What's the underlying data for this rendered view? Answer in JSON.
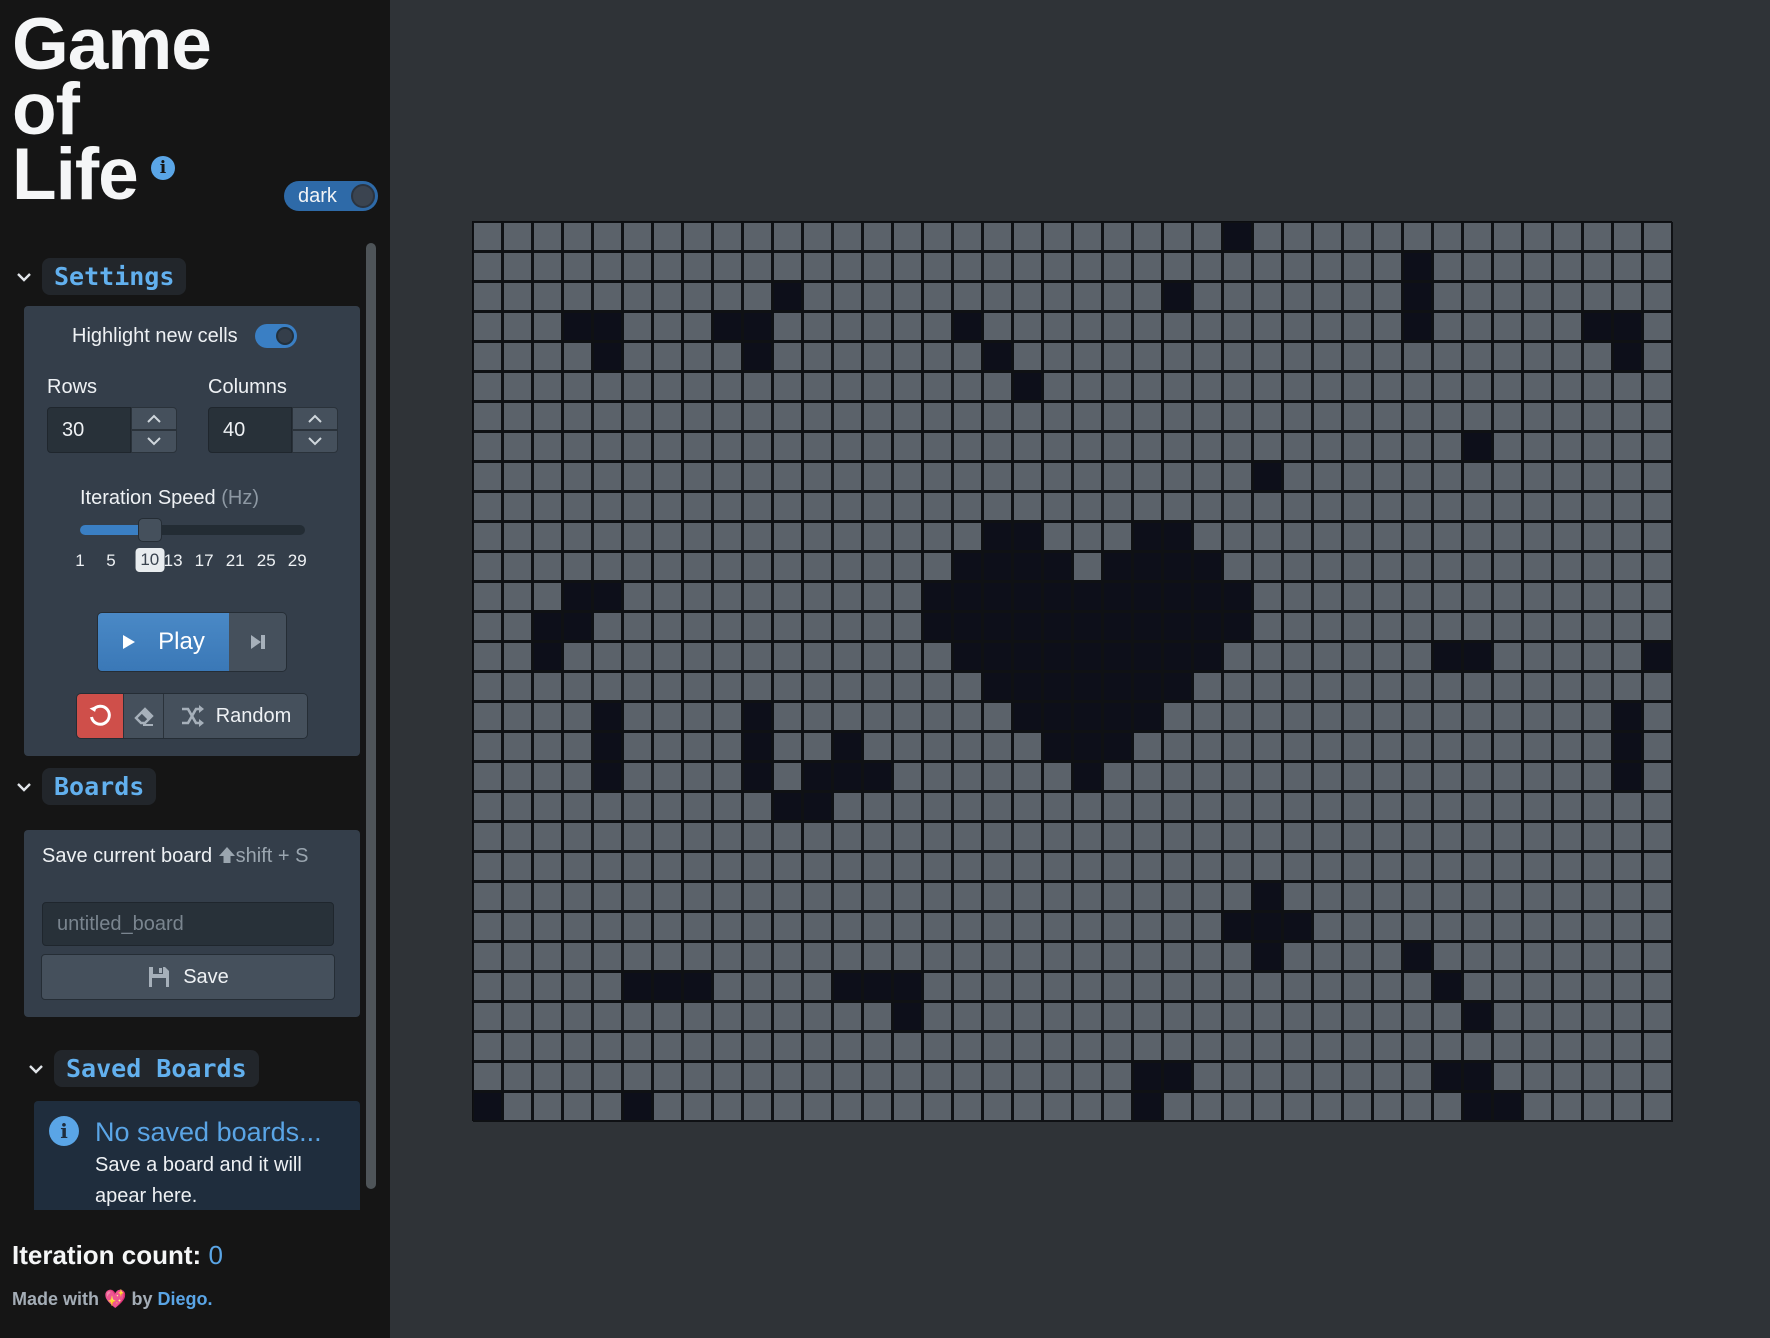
{
  "app": {
    "title_lines": [
      "Game",
      "of",
      "Life"
    ],
    "info_icon": "info-icon",
    "theme_toggle": {
      "label": "dark",
      "on": true
    }
  },
  "settings": {
    "header": "Settings",
    "highlight_new_cells": {
      "label": "Highlight new cells",
      "on": true
    },
    "rows": {
      "label": "Rows",
      "value": "30"
    },
    "columns": {
      "label": "Columns",
      "value": "40"
    },
    "iteration_speed": {
      "label": "Iteration Speed",
      "unit": "(Hz)",
      "value": 10,
      "min": 1,
      "max": 30,
      "ticks": [
        "1",
        "5",
        "10",
        "13",
        "17",
        "21",
        "25",
        "29"
      ],
      "tick_values": [
        1,
        5,
        10,
        13,
        17,
        21,
        25,
        29
      ]
    },
    "play_label": "Play",
    "random_label": "Random",
    "icons": {
      "play": "play-icon",
      "step": "step-forward-icon",
      "reset": "reset-icon",
      "clear": "eraser-icon",
      "random": "shuffle-icon"
    }
  },
  "boards": {
    "header": "Boards",
    "save_label": "Save current board",
    "shortcut": "shift + S",
    "name_placeholder": "untitled_board",
    "name_value": "",
    "save_button": "Save"
  },
  "saved_boards": {
    "header": "Saved Boards",
    "empty_title": "No saved boards...",
    "empty_body": "Save a board and it will apear here."
  },
  "footer": {
    "iteration_label": "Iteration count:",
    "iteration_count": "0",
    "made_with": "Made with",
    "heart": "💖",
    "by": "by",
    "author": "Diego."
  },
  "board": {
    "rows": 30,
    "cols": 40,
    "alive_color": "#0d0f1a",
    "dead_color": "#5b626a",
    "alive_cells": [
      [
        0,
        25
      ],
      [
        1,
        31
      ],
      [
        2,
        10
      ],
      [
        2,
        23
      ],
      [
        2,
        31
      ],
      [
        3,
        3
      ],
      [
        3,
        4
      ],
      [
        3,
        8
      ],
      [
        3,
        9
      ],
      [
        3,
        16
      ],
      [
        3,
        31
      ],
      [
        3,
        37
      ],
      [
        3,
        38
      ],
      [
        4,
        4
      ],
      [
        4,
        9
      ],
      [
        4,
        17
      ],
      [
        4,
        38
      ],
      [
        5,
        18
      ],
      [
        7,
        33
      ],
      [
        8,
        26
      ],
      [
        10,
        17
      ],
      [
        10,
        18
      ],
      [
        10,
        22
      ],
      [
        10,
        23
      ],
      [
        11,
        16
      ],
      [
        11,
        17
      ],
      [
        11,
        18
      ],
      [
        11,
        19
      ],
      [
        11,
        21
      ],
      [
        11,
        22
      ],
      [
        11,
        23
      ],
      [
        11,
        24
      ],
      [
        12,
        3
      ],
      [
        12,
        4
      ],
      [
        12,
        15
      ],
      [
        12,
        16
      ],
      [
        12,
        17
      ],
      [
        12,
        18
      ],
      [
        12,
        19
      ],
      [
        12,
        20
      ],
      [
        12,
        21
      ],
      [
        12,
        22
      ],
      [
        12,
        23
      ],
      [
        12,
        24
      ],
      [
        12,
        25
      ],
      [
        13,
        2
      ],
      [
        13,
        3
      ],
      [
        13,
        15
      ],
      [
        13,
        16
      ],
      [
        13,
        17
      ],
      [
        13,
        18
      ],
      [
        13,
        19
      ],
      [
        13,
        20
      ],
      [
        13,
        21
      ],
      [
        13,
        22
      ],
      [
        13,
        23
      ],
      [
        13,
        24
      ],
      [
        13,
        25
      ],
      [
        14,
        2
      ],
      [
        14,
        16
      ],
      [
        14,
        17
      ],
      [
        14,
        18
      ],
      [
        14,
        19
      ],
      [
        14,
        20
      ],
      [
        14,
        21
      ],
      [
        14,
        22
      ],
      [
        14,
        23
      ],
      [
        14,
        24
      ],
      [
        14,
        32
      ],
      [
        14,
        33
      ],
      [
        14,
        39
      ],
      [
        15,
        17
      ],
      [
        15,
        18
      ],
      [
        15,
        19
      ],
      [
        15,
        20
      ],
      [
        15,
        21
      ],
      [
        15,
        22
      ],
      [
        15,
        23
      ],
      [
        16,
        4
      ],
      [
        16,
        9
      ],
      [
        16,
        18
      ],
      [
        16,
        19
      ],
      [
        16,
        20
      ],
      [
        16,
        21
      ],
      [
        16,
        22
      ],
      [
        16,
        38
      ],
      [
        17,
        4
      ],
      [
        17,
        9
      ],
      [
        17,
        12
      ],
      [
        17,
        19
      ],
      [
        17,
        20
      ],
      [
        17,
        21
      ],
      [
        17,
        38
      ],
      [
        18,
        4
      ],
      [
        18,
        9
      ],
      [
        18,
        11
      ],
      [
        18,
        12
      ],
      [
        18,
        13
      ],
      [
        18,
        20
      ],
      [
        18,
        38
      ],
      [
        19,
        10
      ],
      [
        19,
        11
      ],
      [
        22,
        26
      ],
      [
        23,
        25
      ],
      [
        23,
        26
      ],
      [
        23,
        27
      ],
      [
        24,
        26
      ],
      [
        24,
        31
      ],
      [
        25,
        5
      ],
      [
        25,
        6
      ],
      [
        25,
        7
      ],
      [
        25,
        12
      ],
      [
        25,
        13
      ],
      [
        25,
        14
      ],
      [
        25,
        32
      ],
      [
        26,
        14
      ],
      [
        26,
        33
      ],
      [
        28,
        22
      ],
      [
        28,
        23
      ],
      [
        28,
        32
      ],
      [
        28,
        33
      ],
      [
        29,
        0
      ],
      [
        29,
        5
      ],
      [
        29,
        22
      ],
      [
        29,
        33
      ],
      [
        29,
        34
      ]
    ]
  }
}
